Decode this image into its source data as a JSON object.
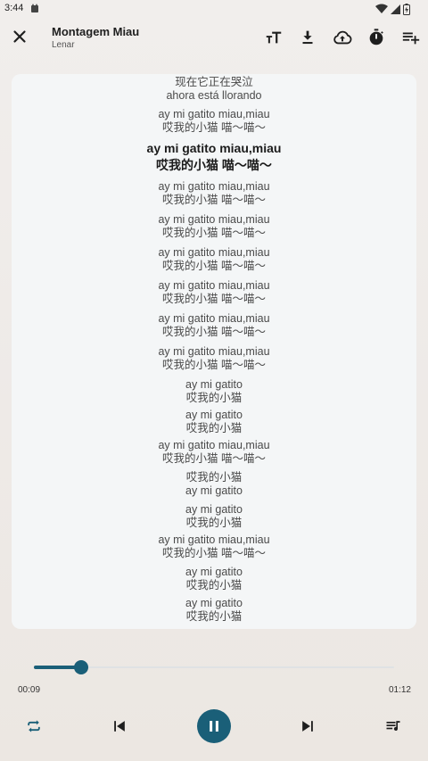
{
  "status_bar": {
    "time": "3:44"
  },
  "header": {
    "title": "Montagem Miau",
    "artist": "Lenar"
  },
  "toolbar": {
    "icons": [
      "text-size-icon",
      "download-icon",
      "cloud-upload-icon",
      "timer-icon",
      "playlist-add-icon"
    ]
  },
  "lyrics": [
    {
      "lines": [
        "现在它正在哭泣",
        "ahora está llorando"
      ],
      "current": false
    },
    {
      "lines": [
        "ay mi gatito miau,miau",
        "哎我的小猫 喵～喵～"
      ],
      "current": false
    },
    {
      "lines": [
        "ay mi gatito miau,miau",
        "哎我的小猫 喵～喵～"
      ],
      "current": true
    },
    {
      "lines": [
        "ay mi gatito miau,miau",
        "哎我的小猫 喵～喵～"
      ],
      "current": false
    },
    {
      "lines": [
        "ay mi gatito miau,miau",
        "哎我的小猫 喵～喵～"
      ],
      "current": false
    },
    {
      "lines": [
        "ay mi gatito miau,miau",
        "哎我的小猫 喵～喵～"
      ],
      "current": false
    },
    {
      "lines": [
        "ay mi gatito miau,miau",
        "哎我的小猫 喵～喵～"
      ],
      "current": false
    },
    {
      "lines": [
        "ay mi gatito miau,miau",
        "哎我的小猫 喵～喵～"
      ],
      "current": false
    },
    {
      "lines": [
        "ay mi gatito miau,miau",
        "哎我的小猫 喵～喵～"
      ],
      "current": false
    },
    {
      "lines": [
        "ay mi gatito",
        "哎我的小猫"
      ],
      "current": false
    },
    {
      "lines": [
        "ay mi gatito",
        "哎我的小猫"
      ],
      "current": false
    },
    {
      "lines": [
        "ay mi gatito miau,miau",
        "哎我的小猫 喵～喵～"
      ],
      "current": false
    },
    {
      "lines": [
        "哎我的小猫",
        "ay mi gatito"
      ],
      "current": false
    },
    {
      "lines": [
        "ay mi gatito",
        "哎我的小猫"
      ],
      "current": false
    },
    {
      "lines": [
        "ay mi gatito miau,miau",
        "哎我的小猫 喵～喵～"
      ],
      "current": false
    },
    {
      "lines": [
        "ay mi gatito",
        "哎我的小猫"
      ],
      "current": false
    },
    {
      "lines": [
        "ay mi gatito",
        "哎我的小猫"
      ],
      "current": false
    }
  ],
  "player": {
    "elapsed": "00:09",
    "total": "01:12",
    "progress_fraction": 0.13,
    "accent_color": "#1a5f78",
    "controls": [
      "repeat-icon",
      "skip-previous-icon",
      "pause-icon",
      "skip-next-icon",
      "queue-icon"
    ]
  }
}
